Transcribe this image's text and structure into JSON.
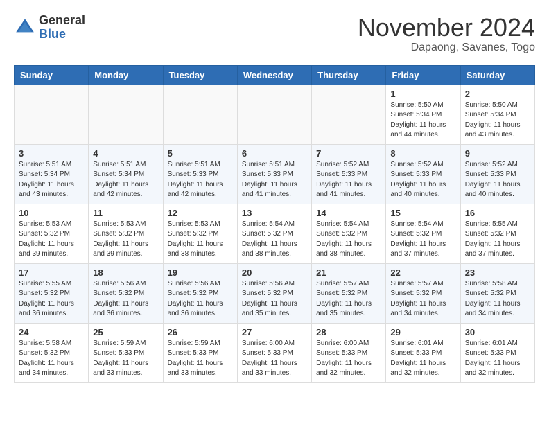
{
  "header": {
    "logo_general": "General",
    "logo_blue": "Blue",
    "month_title": "November 2024",
    "subtitle": "Dapaong, Savanes, Togo"
  },
  "weekdays": [
    "Sunday",
    "Monday",
    "Tuesday",
    "Wednesday",
    "Thursday",
    "Friday",
    "Saturday"
  ],
  "weeks": [
    [
      {
        "day": "",
        "info": ""
      },
      {
        "day": "",
        "info": ""
      },
      {
        "day": "",
        "info": ""
      },
      {
        "day": "",
        "info": ""
      },
      {
        "day": "",
        "info": ""
      },
      {
        "day": "1",
        "info": "Sunrise: 5:50 AM\nSunset: 5:34 PM\nDaylight: 11 hours\nand 44 minutes."
      },
      {
        "day": "2",
        "info": "Sunrise: 5:50 AM\nSunset: 5:34 PM\nDaylight: 11 hours\nand 43 minutes."
      }
    ],
    [
      {
        "day": "3",
        "info": "Sunrise: 5:51 AM\nSunset: 5:34 PM\nDaylight: 11 hours\nand 43 minutes."
      },
      {
        "day": "4",
        "info": "Sunrise: 5:51 AM\nSunset: 5:34 PM\nDaylight: 11 hours\nand 42 minutes."
      },
      {
        "day": "5",
        "info": "Sunrise: 5:51 AM\nSunset: 5:33 PM\nDaylight: 11 hours\nand 42 minutes."
      },
      {
        "day": "6",
        "info": "Sunrise: 5:51 AM\nSunset: 5:33 PM\nDaylight: 11 hours\nand 41 minutes."
      },
      {
        "day": "7",
        "info": "Sunrise: 5:52 AM\nSunset: 5:33 PM\nDaylight: 11 hours\nand 41 minutes."
      },
      {
        "day": "8",
        "info": "Sunrise: 5:52 AM\nSunset: 5:33 PM\nDaylight: 11 hours\nand 40 minutes."
      },
      {
        "day": "9",
        "info": "Sunrise: 5:52 AM\nSunset: 5:33 PM\nDaylight: 11 hours\nand 40 minutes."
      }
    ],
    [
      {
        "day": "10",
        "info": "Sunrise: 5:53 AM\nSunset: 5:32 PM\nDaylight: 11 hours\nand 39 minutes."
      },
      {
        "day": "11",
        "info": "Sunrise: 5:53 AM\nSunset: 5:32 PM\nDaylight: 11 hours\nand 39 minutes."
      },
      {
        "day": "12",
        "info": "Sunrise: 5:53 AM\nSunset: 5:32 PM\nDaylight: 11 hours\nand 38 minutes."
      },
      {
        "day": "13",
        "info": "Sunrise: 5:54 AM\nSunset: 5:32 PM\nDaylight: 11 hours\nand 38 minutes."
      },
      {
        "day": "14",
        "info": "Sunrise: 5:54 AM\nSunset: 5:32 PM\nDaylight: 11 hours\nand 38 minutes."
      },
      {
        "day": "15",
        "info": "Sunrise: 5:54 AM\nSunset: 5:32 PM\nDaylight: 11 hours\nand 37 minutes."
      },
      {
        "day": "16",
        "info": "Sunrise: 5:55 AM\nSunset: 5:32 PM\nDaylight: 11 hours\nand 37 minutes."
      }
    ],
    [
      {
        "day": "17",
        "info": "Sunrise: 5:55 AM\nSunset: 5:32 PM\nDaylight: 11 hours\nand 36 minutes."
      },
      {
        "day": "18",
        "info": "Sunrise: 5:56 AM\nSunset: 5:32 PM\nDaylight: 11 hours\nand 36 minutes."
      },
      {
        "day": "19",
        "info": "Sunrise: 5:56 AM\nSunset: 5:32 PM\nDaylight: 11 hours\nand 36 minutes."
      },
      {
        "day": "20",
        "info": "Sunrise: 5:56 AM\nSunset: 5:32 PM\nDaylight: 11 hours\nand 35 minutes."
      },
      {
        "day": "21",
        "info": "Sunrise: 5:57 AM\nSunset: 5:32 PM\nDaylight: 11 hours\nand 35 minutes."
      },
      {
        "day": "22",
        "info": "Sunrise: 5:57 AM\nSunset: 5:32 PM\nDaylight: 11 hours\nand 34 minutes."
      },
      {
        "day": "23",
        "info": "Sunrise: 5:58 AM\nSunset: 5:32 PM\nDaylight: 11 hours\nand 34 minutes."
      }
    ],
    [
      {
        "day": "24",
        "info": "Sunrise: 5:58 AM\nSunset: 5:32 PM\nDaylight: 11 hours\nand 34 minutes."
      },
      {
        "day": "25",
        "info": "Sunrise: 5:59 AM\nSunset: 5:33 PM\nDaylight: 11 hours\nand 33 minutes."
      },
      {
        "day": "26",
        "info": "Sunrise: 5:59 AM\nSunset: 5:33 PM\nDaylight: 11 hours\nand 33 minutes."
      },
      {
        "day": "27",
        "info": "Sunrise: 6:00 AM\nSunset: 5:33 PM\nDaylight: 11 hours\nand 33 minutes."
      },
      {
        "day": "28",
        "info": "Sunrise: 6:00 AM\nSunset: 5:33 PM\nDaylight: 11 hours\nand 32 minutes."
      },
      {
        "day": "29",
        "info": "Sunrise: 6:01 AM\nSunset: 5:33 PM\nDaylight: 11 hours\nand 32 minutes."
      },
      {
        "day": "30",
        "info": "Sunrise: 6:01 AM\nSunset: 5:33 PM\nDaylight: 11 hours\nand 32 minutes."
      }
    ]
  ]
}
